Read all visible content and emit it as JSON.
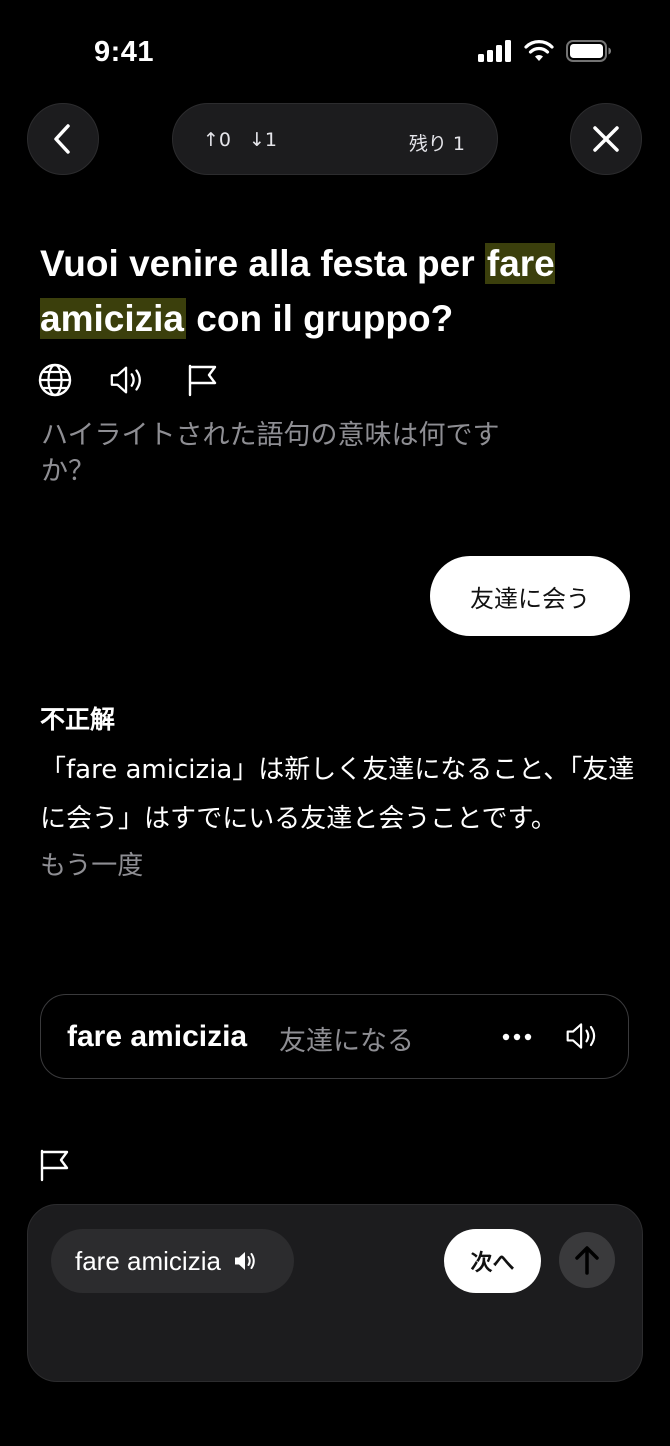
{
  "status_bar": {
    "time": "9:41"
  },
  "header": {
    "up_count": "↑0",
    "down_count": "↓1",
    "remaining": "残り 1"
  },
  "question": {
    "before": "Vuoi venire alla festa per ",
    "highlight": "fare amicizia",
    "after": " con il gruppo?"
  },
  "prompt": "ハイライトされた語句の意味は何ですか？",
  "selected_answer": "友達に会う",
  "feedback": {
    "title": "不正解",
    "explanation": "「fare amicizia」は新しく友達になること、「友達に会う」はすでにいる友達と会うことです。",
    "retry": "もう一度"
  },
  "vocab": {
    "term": "fare amicizia",
    "meaning": "友達になる",
    "more": "•••"
  },
  "input_panel": {
    "chip_label": "fare amicizia",
    "next_label": "次へ"
  },
  "colors": {
    "background": "#000000",
    "highlight": "#3b3f0c",
    "surface": "#1c1c1e",
    "muted_text": "#8e8e93"
  }
}
